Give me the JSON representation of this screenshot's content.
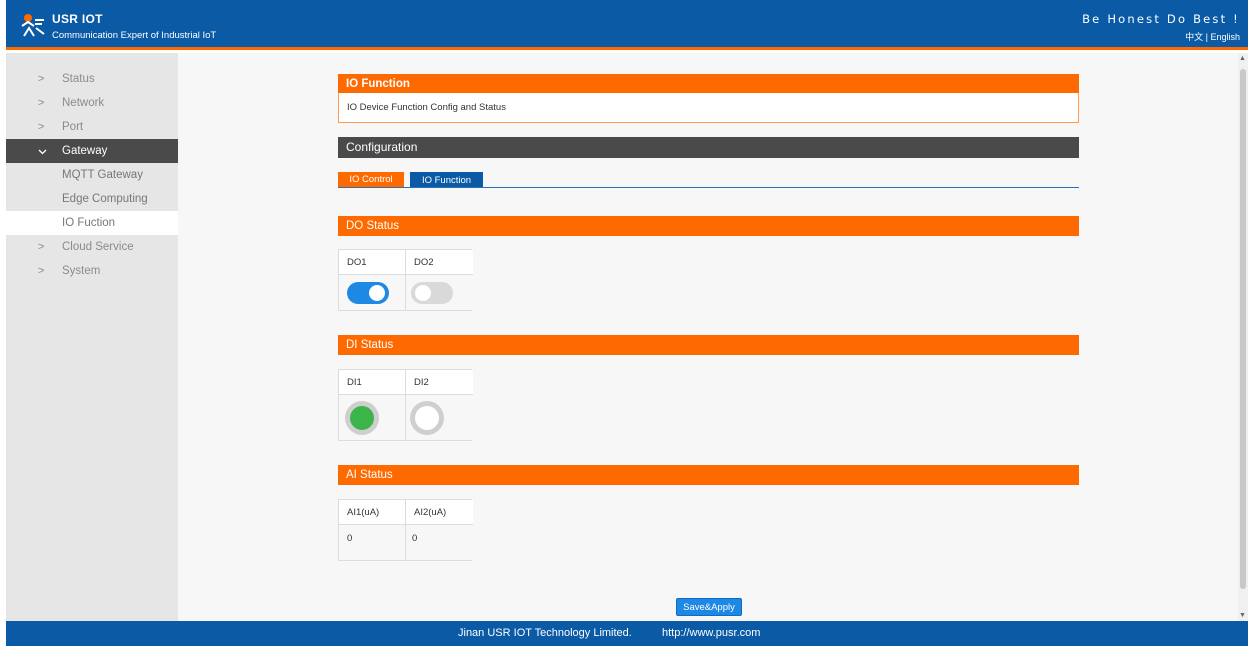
{
  "header": {
    "brand": "USR IOT",
    "subtitle": "Communication Expert of Industrial IoT",
    "slogan": "Be Honest Do Best !",
    "lang_cn": "中文",
    "lang_sep": "|",
    "lang_en": "English",
    "logo_icon": "usr-logo-icon"
  },
  "sidebar": {
    "items": [
      {
        "label": "Status",
        "icon": "chevron-right-icon"
      },
      {
        "label": "Network",
        "icon": "chevron-right-icon"
      },
      {
        "label": "Port",
        "icon": "chevron-right-icon"
      },
      {
        "label": "Gateway",
        "icon": "chevron-down-icon"
      },
      {
        "label": "MQTT Gateway"
      },
      {
        "label": "Edge Computing"
      },
      {
        "label": "IO Fuction"
      },
      {
        "label": "Cloud Service",
        "icon": "chevron-right-icon"
      },
      {
        "label": "System",
        "icon": "chevron-right-icon"
      }
    ]
  },
  "main": {
    "section_title": "IO Function",
    "section_desc": "IO Device Function Config and Status",
    "config_title": "Configuration",
    "tabs": [
      {
        "label": "IO Control"
      },
      {
        "label": "IO Function"
      }
    ],
    "do_status": {
      "title": "DO Status",
      "columns": [
        "DO1",
        "DO2"
      ],
      "states": [
        "on",
        "off"
      ]
    },
    "di_status": {
      "title": "DI Status",
      "columns": [
        "DI1",
        "DI2"
      ],
      "states": [
        "on",
        "off"
      ]
    },
    "ai_status": {
      "title": "AI Status",
      "columns": [
        "AI1(uA)",
        "AI2(uA)"
      ],
      "values": [
        "0",
        "0"
      ]
    },
    "save_label": "Save&Apply"
  },
  "footer": {
    "company": "Jinan USR IOT Technology Limited.",
    "url": "http://www.pusr.com"
  },
  "colors": {
    "header_blue": "#0a5aa6",
    "accent_orange": "#ff6a00",
    "dark_bar": "#4a4a4a",
    "toggle_on": "#1e88e5",
    "led_green": "#3bb54a"
  }
}
